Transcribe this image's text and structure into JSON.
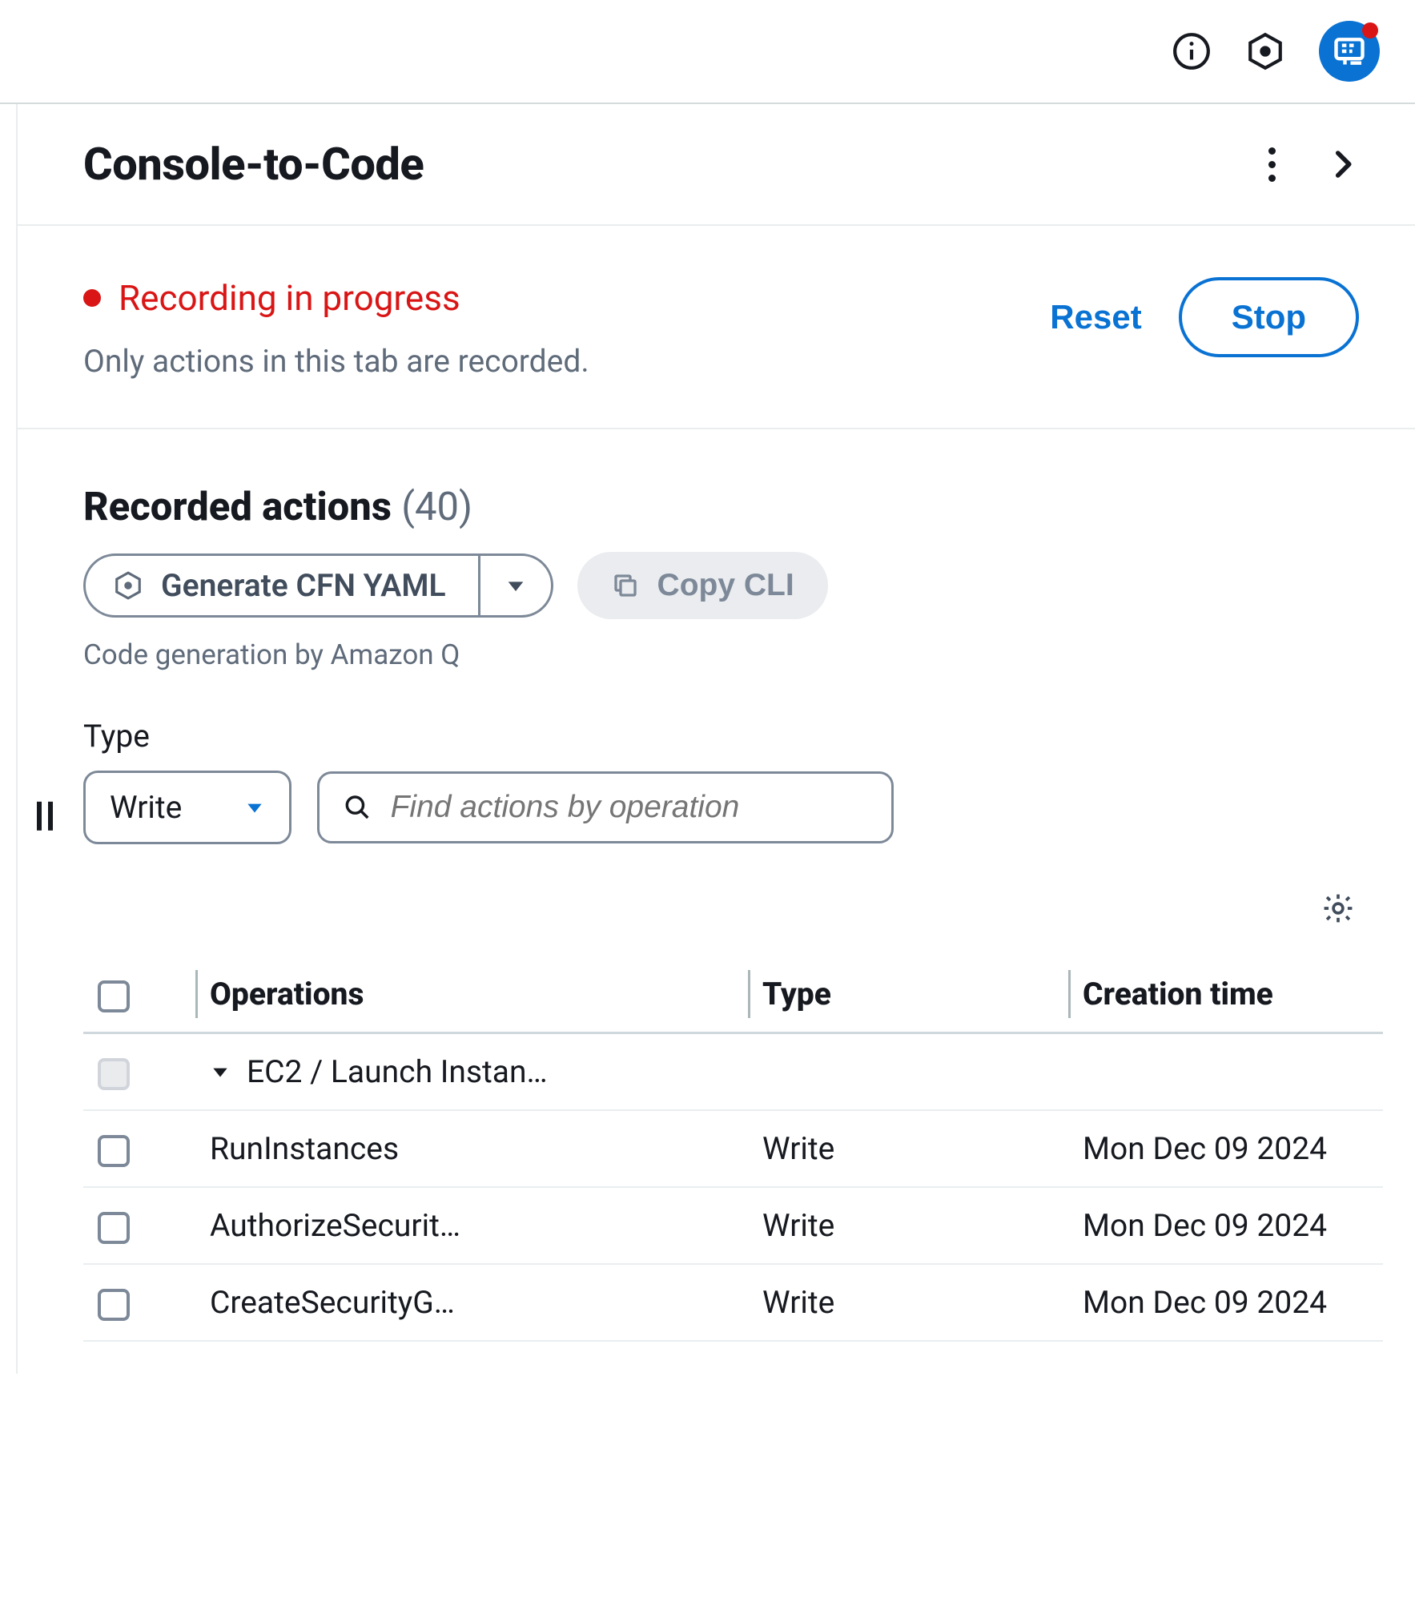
{
  "topbar": {
    "icons": [
      "info-icon",
      "hex-icon",
      "q-assistant-icon"
    ]
  },
  "panel": {
    "title": "Console-to-Code"
  },
  "recording": {
    "status_text": "Recording in progress",
    "subtext": "Only actions in this tab are recorded.",
    "reset_label": "Reset",
    "stop_label": "Stop"
  },
  "recorded": {
    "heading": "Recorded actions",
    "count": "(40)",
    "generate_label": "Generate CFN YAML",
    "copy_label": "Copy CLI",
    "helper": "Code generation by Amazon Q"
  },
  "filter": {
    "label": "Type",
    "selected": "Write",
    "search_placeholder": "Find actions by operation"
  },
  "table": {
    "headers": {
      "operations": "Operations",
      "type": "Type",
      "creation": "Creation time"
    },
    "group": {
      "label": "EC2 / Launch Instan…"
    },
    "rows": [
      {
        "operation": "RunInstances",
        "type": "Write",
        "created": "Mon Dec 09 2024"
      },
      {
        "operation": "AuthorizeSecurit…",
        "type": "Write",
        "created": "Mon Dec 09 2024"
      },
      {
        "operation": "CreateSecurityG…",
        "type": "Write",
        "created": "Mon Dec 09 2024"
      }
    ]
  }
}
